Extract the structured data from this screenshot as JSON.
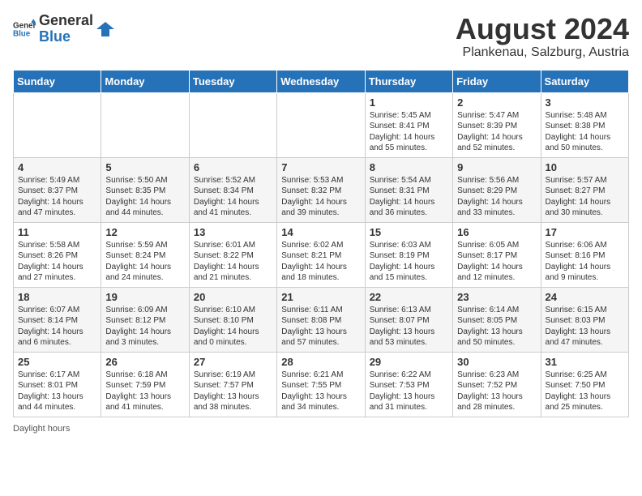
{
  "header": {
    "logo_general": "General",
    "logo_blue": "Blue",
    "month_title": "August 2024",
    "location": "Plankenau, Salzburg, Austria"
  },
  "days_of_week": [
    "Sunday",
    "Monday",
    "Tuesday",
    "Wednesday",
    "Thursday",
    "Friday",
    "Saturday"
  ],
  "weeks": [
    [
      {
        "day": "",
        "content": ""
      },
      {
        "day": "",
        "content": ""
      },
      {
        "day": "",
        "content": ""
      },
      {
        "day": "",
        "content": ""
      },
      {
        "day": "1",
        "content": "Sunrise: 5:45 AM\nSunset: 8:41 PM\nDaylight: 14 hours and 55 minutes."
      },
      {
        "day": "2",
        "content": "Sunrise: 5:47 AM\nSunset: 8:39 PM\nDaylight: 14 hours and 52 minutes."
      },
      {
        "day": "3",
        "content": "Sunrise: 5:48 AM\nSunset: 8:38 PM\nDaylight: 14 hours and 50 minutes."
      }
    ],
    [
      {
        "day": "4",
        "content": "Sunrise: 5:49 AM\nSunset: 8:37 PM\nDaylight: 14 hours and 47 minutes."
      },
      {
        "day": "5",
        "content": "Sunrise: 5:50 AM\nSunset: 8:35 PM\nDaylight: 14 hours and 44 minutes."
      },
      {
        "day": "6",
        "content": "Sunrise: 5:52 AM\nSunset: 8:34 PM\nDaylight: 14 hours and 41 minutes."
      },
      {
        "day": "7",
        "content": "Sunrise: 5:53 AM\nSunset: 8:32 PM\nDaylight: 14 hours and 39 minutes."
      },
      {
        "day": "8",
        "content": "Sunrise: 5:54 AM\nSunset: 8:31 PM\nDaylight: 14 hours and 36 minutes."
      },
      {
        "day": "9",
        "content": "Sunrise: 5:56 AM\nSunset: 8:29 PM\nDaylight: 14 hours and 33 minutes."
      },
      {
        "day": "10",
        "content": "Sunrise: 5:57 AM\nSunset: 8:27 PM\nDaylight: 14 hours and 30 minutes."
      }
    ],
    [
      {
        "day": "11",
        "content": "Sunrise: 5:58 AM\nSunset: 8:26 PM\nDaylight: 14 hours and 27 minutes."
      },
      {
        "day": "12",
        "content": "Sunrise: 5:59 AM\nSunset: 8:24 PM\nDaylight: 14 hours and 24 minutes."
      },
      {
        "day": "13",
        "content": "Sunrise: 6:01 AM\nSunset: 8:22 PM\nDaylight: 14 hours and 21 minutes."
      },
      {
        "day": "14",
        "content": "Sunrise: 6:02 AM\nSunset: 8:21 PM\nDaylight: 14 hours and 18 minutes."
      },
      {
        "day": "15",
        "content": "Sunrise: 6:03 AM\nSunset: 8:19 PM\nDaylight: 14 hours and 15 minutes."
      },
      {
        "day": "16",
        "content": "Sunrise: 6:05 AM\nSunset: 8:17 PM\nDaylight: 14 hours and 12 minutes."
      },
      {
        "day": "17",
        "content": "Sunrise: 6:06 AM\nSunset: 8:16 PM\nDaylight: 14 hours and 9 minutes."
      }
    ],
    [
      {
        "day": "18",
        "content": "Sunrise: 6:07 AM\nSunset: 8:14 PM\nDaylight: 14 hours and 6 minutes."
      },
      {
        "day": "19",
        "content": "Sunrise: 6:09 AM\nSunset: 8:12 PM\nDaylight: 14 hours and 3 minutes."
      },
      {
        "day": "20",
        "content": "Sunrise: 6:10 AM\nSunset: 8:10 PM\nDaylight: 14 hours and 0 minutes."
      },
      {
        "day": "21",
        "content": "Sunrise: 6:11 AM\nSunset: 8:08 PM\nDaylight: 13 hours and 57 minutes."
      },
      {
        "day": "22",
        "content": "Sunrise: 6:13 AM\nSunset: 8:07 PM\nDaylight: 13 hours and 53 minutes."
      },
      {
        "day": "23",
        "content": "Sunrise: 6:14 AM\nSunset: 8:05 PM\nDaylight: 13 hours and 50 minutes."
      },
      {
        "day": "24",
        "content": "Sunrise: 6:15 AM\nSunset: 8:03 PM\nDaylight: 13 hours and 47 minutes."
      }
    ],
    [
      {
        "day": "25",
        "content": "Sunrise: 6:17 AM\nSunset: 8:01 PM\nDaylight: 13 hours and 44 minutes."
      },
      {
        "day": "26",
        "content": "Sunrise: 6:18 AM\nSunset: 7:59 PM\nDaylight: 13 hours and 41 minutes."
      },
      {
        "day": "27",
        "content": "Sunrise: 6:19 AM\nSunset: 7:57 PM\nDaylight: 13 hours and 38 minutes."
      },
      {
        "day": "28",
        "content": "Sunrise: 6:21 AM\nSunset: 7:55 PM\nDaylight: 13 hours and 34 minutes."
      },
      {
        "day": "29",
        "content": "Sunrise: 6:22 AM\nSunset: 7:53 PM\nDaylight: 13 hours and 31 minutes."
      },
      {
        "day": "30",
        "content": "Sunrise: 6:23 AM\nSunset: 7:52 PM\nDaylight: 13 hours and 28 minutes."
      },
      {
        "day": "31",
        "content": "Sunrise: 6:25 AM\nSunset: 7:50 PM\nDaylight: 13 hours and 25 minutes."
      }
    ]
  ],
  "footer": {
    "daylight_hours_label": "Daylight hours"
  }
}
